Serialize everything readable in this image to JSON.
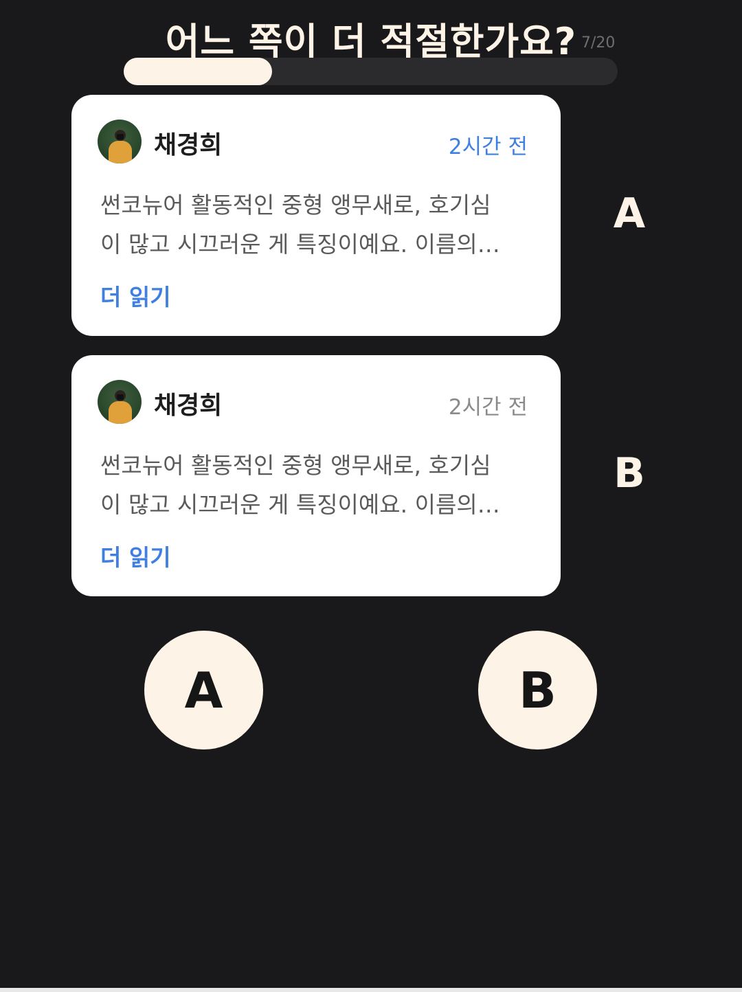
{
  "header": {
    "question": "어느 쪽이 더 적절한가요?",
    "counter": "7/20",
    "progress": 0.3
  },
  "cards": [
    {
      "id": "A",
      "author": "채경희",
      "time": "2시간 전",
      "time_color": "#3f7fe0",
      "text_lines": [
        "썬코뉴어 활동적인 중형 앵무새로, 호기심",
        "이 많고 시끄러운 게 특징이예요. 이름의…"
      ],
      "read_more": "더 읽기"
    },
    {
      "id": "B",
      "author": "채경희",
      "time": "2시간 전",
      "time_color": "#8a8a8a",
      "text_lines": [
        "썬코뉴어 활동적인 중형 앵무새로, 호기심",
        "이 많고 시끄러운 게 특징이예요. 이름의…"
      ],
      "read_more": "더 읽기"
    }
  ],
  "side_labels": [
    "A",
    "B"
  ],
  "choices": [
    "A",
    "B"
  ],
  "colors": {
    "background": "#19191b",
    "accent": "#fdf3e6",
    "link": "#3f7fe0"
  }
}
